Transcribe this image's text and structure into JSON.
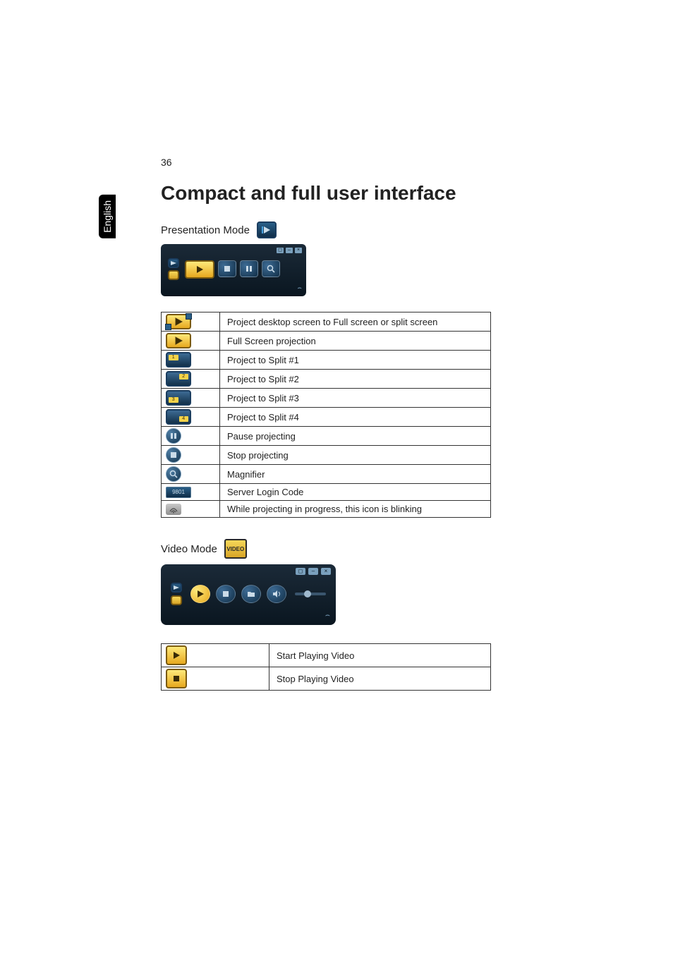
{
  "page_number": "36",
  "language_tab": "English",
  "title": "Compact and full user interface",
  "presentation_mode_label": "Presentation Mode",
  "video_mode_label": "Video Mode",
  "server_code_sample": "9801",
  "presentation_table": [
    {
      "icon": "split-play",
      "desc": "Project desktop screen to Full screen or split screen"
    },
    {
      "icon": "full-play",
      "desc": "Full Screen projection"
    },
    {
      "icon": "split-1",
      "desc": "Project to Split #1"
    },
    {
      "icon": "split-2",
      "desc": "Project to Split #2"
    },
    {
      "icon": "split-3",
      "desc": "Project to Split #3"
    },
    {
      "icon": "split-4",
      "desc": "Project to Split #4"
    },
    {
      "icon": "pause",
      "desc": "Pause projecting"
    },
    {
      "icon": "stop",
      "desc": "Stop projecting"
    },
    {
      "icon": "magnifier",
      "desc": "Magnifier"
    },
    {
      "icon": "server-code",
      "desc": "Server Login Code"
    },
    {
      "icon": "wifi-blink",
      "desc": "While projecting in progress, this icon is blinking"
    }
  ],
  "video_table": [
    {
      "icon": "video-play",
      "desc": "Start Playing Video"
    },
    {
      "icon": "video-stop",
      "desc": "Stop Playing Video"
    }
  ],
  "video_mode_icon_text": "VIDEO"
}
